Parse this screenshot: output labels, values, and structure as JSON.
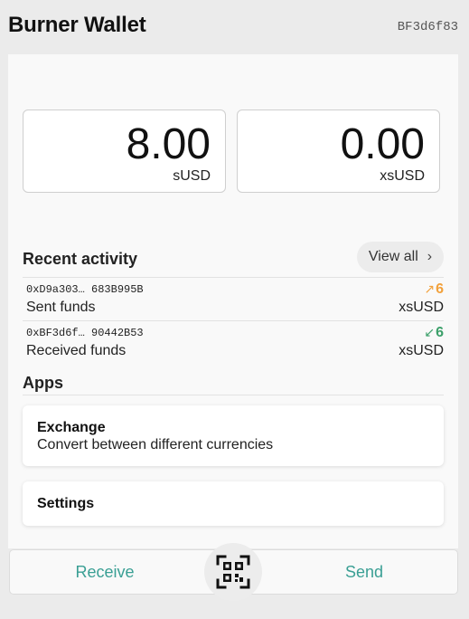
{
  "header": {
    "title": "Burner Wallet",
    "account": "BF3d6f83"
  },
  "balances": [
    {
      "amount": "8.00",
      "unit": "sUSD"
    },
    {
      "amount": "0.00",
      "unit": "xsUSD"
    }
  ],
  "recent": {
    "title": "Recent activity",
    "view_all": "View all",
    "items": [
      {
        "address": "0xD9a303… 683B995B",
        "description": "Sent funds",
        "arrow": "↗",
        "amount": "6",
        "currency": "xsUSD",
        "direction": "sent"
      },
      {
        "address": "0xBF3d6f… 90442B53",
        "description": "Received funds",
        "arrow": "↙",
        "amount": "6",
        "currency": "xsUSD",
        "direction": "received"
      }
    ]
  },
  "apps": {
    "title": "Apps",
    "items": [
      {
        "name": "Exchange",
        "subtitle": "Convert between different currencies"
      },
      {
        "name": "Settings"
      }
    ]
  },
  "bottom": {
    "receive": "Receive",
    "send": "Send",
    "scan_icon": "qr-code-icon"
  },
  "colors": {
    "accent": "#3a9f94",
    "sent": "#f2a13b",
    "received": "#3ca06a"
  }
}
